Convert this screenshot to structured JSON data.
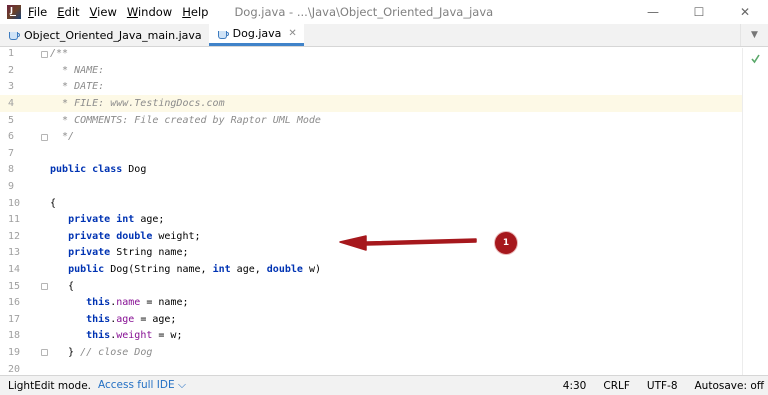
{
  "window": {
    "title": "Dog.java - ...\\Java\\Object_Oriented_Java_java",
    "controls": {
      "minimize": "—",
      "maximize": "☐",
      "close": "✕"
    }
  },
  "menu": {
    "items": [
      {
        "underline": "F",
        "rest": "ile"
      },
      {
        "underline": "E",
        "rest": "dit"
      },
      {
        "underline": "V",
        "rest": "iew"
      },
      {
        "underline": "W",
        "rest": "indow"
      },
      {
        "underline": "H",
        "rest": "elp"
      }
    ]
  },
  "tabs": [
    {
      "label": "Object_Oriented_Java_main.java",
      "active": false
    },
    {
      "label": "Dog.java",
      "active": true,
      "close": "✕"
    }
  ],
  "tabbar": {
    "dropdown": "▼"
  },
  "editor": {
    "caret_line": 4,
    "lines": [
      {
        "n": "1",
        "fold": true,
        "parts": [
          {
            "t": "/**",
            "c": "cm"
          }
        ]
      },
      {
        "n": "2",
        "parts": [
          {
            "t": "  * NAME:",
            "c": "cm"
          }
        ]
      },
      {
        "n": "3",
        "parts": [
          {
            "t": "  * DATE:",
            "c": "cm"
          }
        ]
      },
      {
        "n": "4",
        "parts": [
          {
            "t": "  * FILE: www.TestingDocs.com",
            "c": "cm"
          }
        ]
      },
      {
        "n": "5",
        "parts": [
          {
            "t": "  * COMMENTS: File created by Raptor UML Mode",
            "c": "cm"
          }
        ]
      },
      {
        "n": "6",
        "fold": true,
        "parts": [
          {
            "t": "  */",
            "c": "cm"
          }
        ]
      },
      {
        "n": "7",
        "parts": []
      },
      {
        "n": "8",
        "parts": [
          {
            "t": "public class ",
            "c": "kw"
          },
          {
            "t": "Dog",
            "c": "plain"
          }
        ]
      },
      {
        "n": "9",
        "parts": []
      },
      {
        "n": "10",
        "parts": [
          {
            "t": "{",
            "c": "plain"
          }
        ]
      },
      {
        "n": "11",
        "parts": [
          {
            "t": "   ",
            "c": "plain"
          },
          {
            "t": "private int ",
            "c": "kw"
          },
          {
            "t": "age;",
            "c": "plain"
          }
        ]
      },
      {
        "n": "12",
        "parts": [
          {
            "t": "   ",
            "c": "plain"
          },
          {
            "t": "private double ",
            "c": "kw"
          },
          {
            "t": "weight;",
            "c": "plain"
          }
        ]
      },
      {
        "n": "13",
        "parts": [
          {
            "t": "   ",
            "c": "plain"
          },
          {
            "t": "private ",
            "c": "kw"
          },
          {
            "t": "String name;",
            "c": "plain"
          }
        ]
      },
      {
        "n": "14",
        "parts": [
          {
            "t": "   ",
            "c": "plain"
          },
          {
            "t": "public ",
            "c": "kw"
          },
          {
            "t": "Dog(String name, ",
            "c": "plain"
          },
          {
            "t": "int ",
            "c": "kw"
          },
          {
            "t": "age, ",
            "c": "plain"
          },
          {
            "t": "double ",
            "c": "kw"
          },
          {
            "t": "w)",
            "c": "plain"
          }
        ]
      },
      {
        "n": "15",
        "fold": true,
        "parts": [
          {
            "t": "   {",
            "c": "plain"
          }
        ]
      },
      {
        "n": "16",
        "parts": [
          {
            "t": "      ",
            "c": "plain"
          },
          {
            "t": "this",
            "c": "kw"
          },
          {
            "t": ".",
            "c": "plain"
          },
          {
            "t": "name",
            "c": "fld"
          },
          {
            "t": " = name;",
            "c": "plain"
          }
        ]
      },
      {
        "n": "17",
        "parts": [
          {
            "t": "      ",
            "c": "plain"
          },
          {
            "t": "this",
            "c": "kw"
          },
          {
            "t": ".",
            "c": "plain"
          },
          {
            "t": "age",
            "c": "fld"
          },
          {
            "t": " = age;",
            "c": "plain"
          }
        ]
      },
      {
        "n": "18",
        "parts": [
          {
            "t": "      ",
            "c": "plain"
          },
          {
            "t": "this",
            "c": "kw"
          },
          {
            "t": ".",
            "c": "plain"
          },
          {
            "t": "weight",
            "c": "fld"
          },
          {
            "t": " = w;",
            "c": "plain"
          }
        ]
      },
      {
        "n": "19",
        "fold": true,
        "parts": [
          {
            "t": "   } ",
            "c": "plain"
          },
          {
            "t": "// close Dog",
            "c": "cm"
          }
        ]
      },
      {
        "n": "20",
        "parts": []
      }
    ]
  },
  "annotation": {
    "badge": "1",
    "color": "#a6181d"
  },
  "status": {
    "mode": "LightEdit mode.",
    "link": "Access full IDE ⌵",
    "position": "4:30",
    "line_sep": "CRLF",
    "encoding": "UTF-8",
    "autosave": "Autosave: off"
  }
}
